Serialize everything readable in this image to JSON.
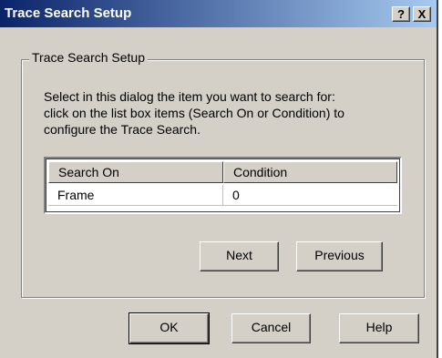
{
  "window": {
    "title": "Trace Search Setup",
    "help_glyph": "?",
    "close_glyph": "X"
  },
  "group": {
    "label": "Trace Search Setup"
  },
  "description": {
    "line1": "Select in this dialog the item you want to search for:",
    "line2": "click on the list box items (Search On or Condition) to",
    "line3": "configure the Trace Search."
  },
  "listbox": {
    "columns": [
      "Search On",
      "Condition"
    ],
    "rows": [
      [
        "Frame",
        "0"
      ]
    ]
  },
  "buttons": {
    "next": "Next",
    "previous": "Previous",
    "ok": "OK",
    "cancel": "Cancel",
    "help": "Help"
  },
  "colors": {
    "title_start": "#0a246a",
    "title_end": "#a6caf0",
    "face": "#d4d0c8"
  }
}
